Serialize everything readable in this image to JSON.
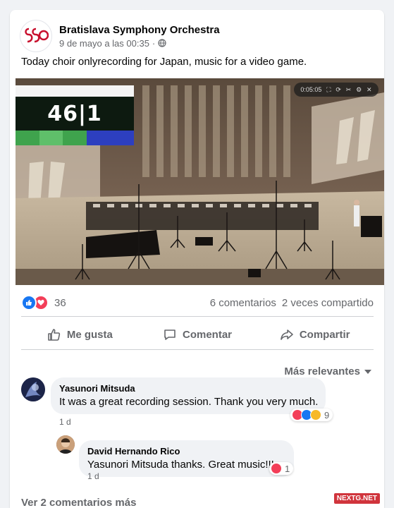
{
  "post": {
    "page_name": "Bratislava Symphony Orchestra",
    "timestamp": "9 de mayo a las 00:35",
    "separator": "·",
    "text": "Today choir onlyrecording for Japan, music for a video game.",
    "logo_text": "BSO"
  },
  "video": {
    "overlay_counter": "46|1",
    "player_time": "0:05:05",
    "player_icons": [
      "fullscreen-icon",
      "reload-icon",
      "crop-icon",
      "settings-icon",
      "close-icon"
    ]
  },
  "stats": {
    "reactions": [
      "like",
      "love"
    ],
    "reaction_count": "36",
    "comments": "6 comentarios",
    "shares": "2 veces compartido"
  },
  "actions": {
    "like": "Me gusta",
    "comment": "Comentar",
    "share": "Compartir"
  },
  "sort": {
    "label": "Más relevantes"
  },
  "comments": [
    {
      "author": "Yasunori Mitsuda",
      "text": "It was a great recording session. Thank you very much.",
      "reactions": [
        "love",
        "like",
        "wow"
      ],
      "reaction_count": "9",
      "time": "1 d"
    },
    {
      "author": "David Hernando Rico",
      "text": "Yasunori Mitsuda thanks. Great music!!!.",
      "reactions": [
        "love"
      ],
      "reaction_count": "1",
      "time": "1 d"
    }
  ],
  "more_comments": "Ver 2 comentarios más",
  "watermark": "NEXTG.NET",
  "colors": {
    "like_blue": "#1877f2",
    "love_red": "#f33e58",
    "wow_yellow": "#f7b928",
    "secondary_text": "#65676b",
    "background": "#f0f2f5"
  }
}
